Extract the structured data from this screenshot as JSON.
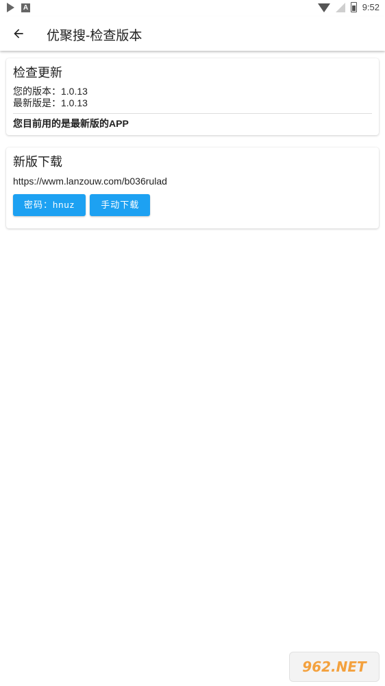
{
  "status_bar": {
    "time": "9:52",
    "icons": [
      "play-store-icon",
      "a-notification-icon",
      "wifi-icon",
      "signal-icon",
      "battery-icon"
    ]
  },
  "app_bar": {
    "title": "优聚搜-检查版本",
    "back_icon": "arrow-left-icon"
  },
  "update_card": {
    "title": "检查更新",
    "your_version": "您的版本：1.0.13",
    "latest_version": "最新版是：1.0.13",
    "status": "您目前用的是最新版的APP"
  },
  "download_card": {
    "title": "新版下载",
    "url": "https://wwm.lanzouw.com/b036rulad",
    "password_button": "密码：hnuz",
    "manual_download_button": "手动下载"
  },
  "colors": {
    "button": "#1da1f2",
    "watermark": "#f39c34"
  },
  "watermark": {
    "text": "962.NET"
  }
}
